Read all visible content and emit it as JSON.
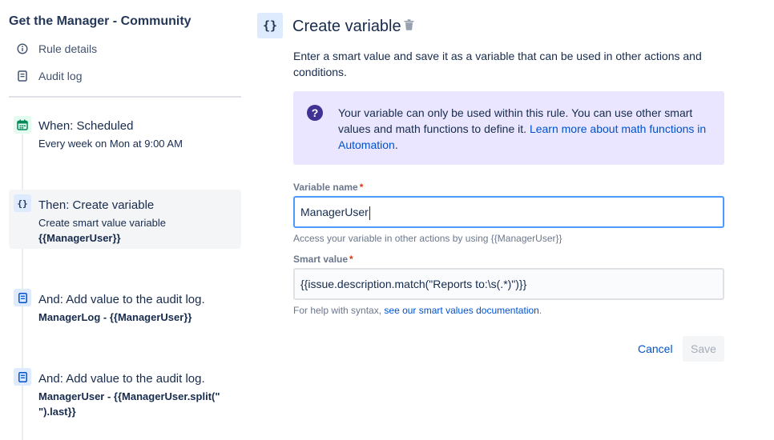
{
  "sidebar": {
    "rule_title": "Get the Manager - Community",
    "links": [
      {
        "label": "Rule details",
        "icon": "info-icon"
      },
      {
        "label": "Audit log",
        "icon": "audit-log-icon"
      }
    ],
    "components": [
      {
        "title": "When: Scheduled",
        "subtitle": "Every week on Mon at 9:00 AM",
        "icon": "calendar-icon",
        "selected": false
      },
      {
        "title": "Then: Create variable",
        "subtitle": "Create smart value variable",
        "detail": "{{ManagerUser}}",
        "icon": "braces-icon",
        "selected": true
      },
      {
        "title": "And: Add value to the audit log.",
        "detail": "ManagerLog - {{ManagerUser}}",
        "icon": "audit-log-icon",
        "selected": false
      },
      {
        "title": "And: Add value to the audit log.",
        "detail_line1": "ManagerUser - {{ManagerUser.split(\"",
        "detail_line2": "\").last}}",
        "icon": "audit-log-icon",
        "selected": false
      }
    ]
  },
  "panel": {
    "icon_glyph": "{}",
    "title": "Create variable",
    "description": "Enter a smart value and save it as a variable that can be used in other actions and conditions.",
    "info": {
      "text": "Your variable can only be used within this rule. You can use other smart values and math functions to define it. ",
      "link_text": "Learn more about math functions in Automation",
      "trailing": "."
    },
    "variable_name": {
      "label": "Variable name",
      "required_mark": "*",
      "value": "ManagerUser",
      "helper": "Access your variable in other actions by using {{ManagerUser}}"
    },
    "smart_value": {
      "label": "Smart value",
      "required_mark": "*",
      "value": "{{issue.description.match(\"Reports to:\\s(.*)\")}}",
      "helper_prefix": "For help with syntax, ",
      "helper_link": "see our smart values documentation",
      "helper_suffix": "."
    },
    "buttons": {
      "cancel": "Cancel",
      "save": "Save"
    }
  },
  "colors": {
    "accent": "#0052cc",
    "info_bg": "#eae6ff",
    "info_icon": "#403294",
    "focus_border": "#4c9aff",
    "selected_bg": "#f4f5f7",
    "required": "#de350b"
  }
}
